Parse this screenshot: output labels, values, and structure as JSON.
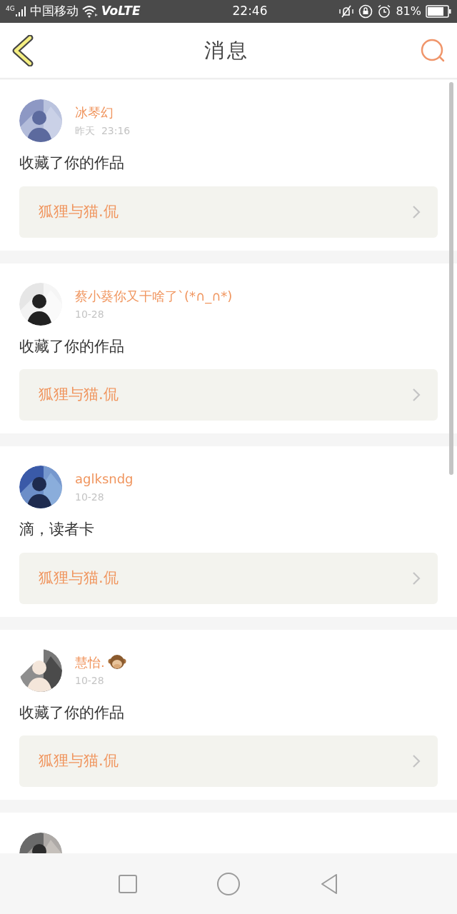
{
  "status_bar": {
    "network": "4G",
    "carrier": "中国移动",
    "volte": "VoLTE",
    "time": "22:46",
    "battery": "81%"
  },
  "header": {
    "title": "消息"
  },
  "messages": [
    {
      "kind": "full",
      "user": "冰琴幻",
      "badge_icon": false,
      "time": "昨天  23:16",
      "text": "收藏了你的作品",
      "work": "狐狸与猫.侃"
    },
    {
      "kind": "full",
      "user": "蔡小葵你又干啥了`(*∩_∩*)",
      "badge_icon": false,
      "time": "10-28",
      "text": "收藏了你的作品",
      "work": "狐狸与猫.侃"
    },
    {
      "kind": "full",
      "user": "aglksndg",
      "badge_icon": false,
      "time": "10-28",
      "text": "滴，读者卡",
      "work": "狐狸与猫.侃"
    },
    {
      "kind": "full",
      "user": "慧怡.",
      "badge_icon": true,
      "time": "10-28",
      "text": "收藏了你的作品",
      "work": "狐狸与猫.侃"
    },
    {
      "kind": "partial"
    }
  ]
}
